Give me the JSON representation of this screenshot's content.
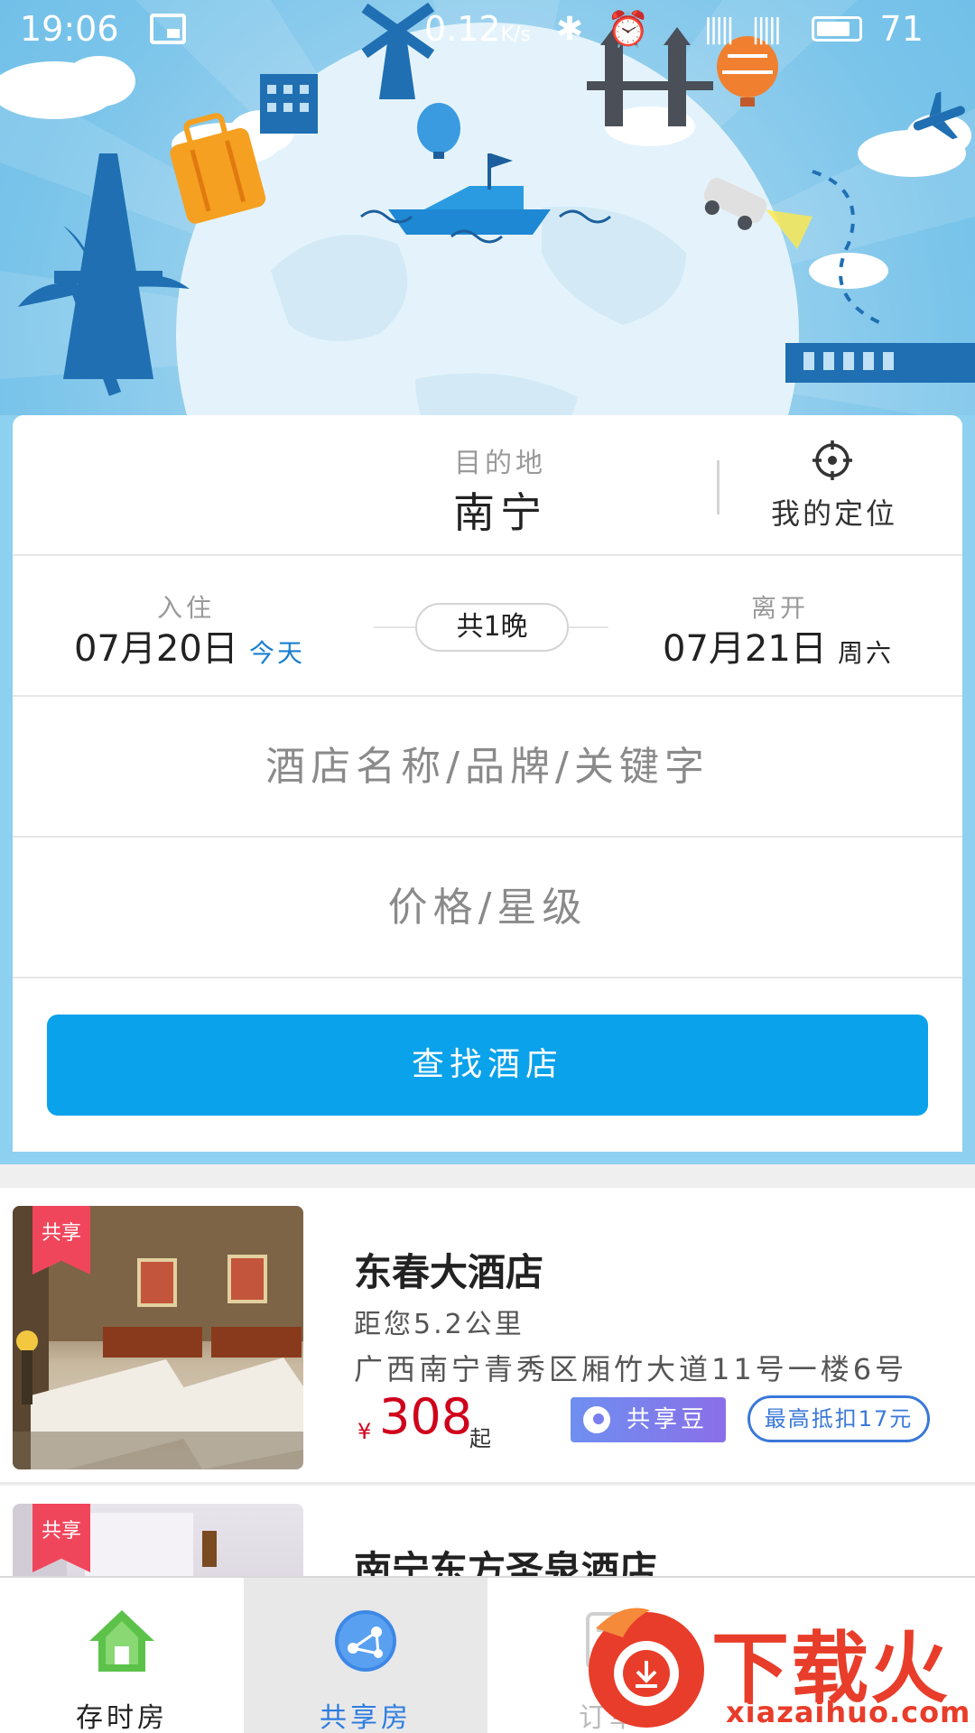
{
  "status_bar": {
    "time": "19:06",
    "net_speed": "0.12",
    "net_speed_unit": "K/s",
    "battery_level": "71",
    "icons": [
      "gallery-icon",
      "bluetooth-icon",
      "alarm-icon",
      "signal-icon",
      "battery-icon"
    ]
  },
  "search": {
    "destination_label": "目的地",
    "destination_value": "南宁",
    "my_location_label": "我的定位",
    "checkin_label": "入住",
    "checkin_date": "07月20日",
    "checkin_note": "今天",
    "nights": "共1晚",
    "checkout_label": "离开",
    "checkout_date": "07月21日",
    "checkout_note": "周六",
    "keyword_placeholder": "酒店名称/品牌/关键字",
    "price_placeholder": "价格/星级",
    "search_button": "查找酒店"
  },
  "hotels": [
    {
      "tag": "共享",
      "name": "东春大酒店",
      "distance": "距您5.2公里",
      "address": "广西南宁青秀区厢竹大道11号一楼6号",
      "price_symbol": "¥",
      "price": "308",
      "price_suffix": "起",
      "bean_badge": "共享豆",
      "deduct_badge": "最高抵扣17元"
    },
    {
      "tag": "共享",
      "name": "南宁东方圣泉酒店"
    }
  ],
  "tabs": [
    {
      "label": "存时房",
      "icon": "home-icon",
      "active": false
    },
    {
      "label": "共享房",
      "icon": "share-network-icon",
      "active": true
    },
    {
      "label": "订单",
      "icon": "order-icon",
      "active": false
    }
  ],
  "watermark": {
    "text": "下载火",
    "url": "xiazaihuo.com"
  },
  "colors": {
    "primary": "#0aa2ea",
    "price": "#d0021b",
    "tag": "#f0465c",
    "active_tab": "#2e7de0",
    "home_icon": "#5cc24a"
  }
}
